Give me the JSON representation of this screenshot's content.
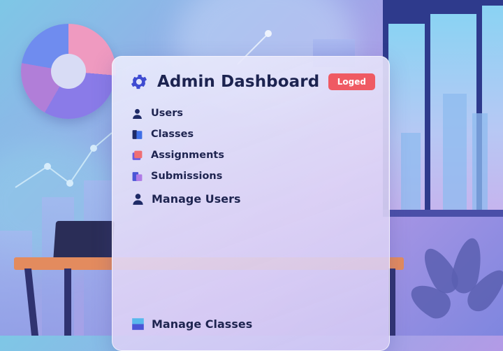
{
  "header": {
    "title": "Admin Dashboard",
    "status_badge": "Loged",
    "icon": "gear-icon"
  },
  "nav": {
    "items": [
      {
        "label": "Users",
        "icon": "user-icon"
      },
      {
        "label": "Classes",
        "icon": "classes-icon"
      },
      {
        "label": "Assignments",
        "icon": "assignments-icon"
      },
      {
        "label": "Submissions",
        "icon": "submissions-icon"
      }
    ]
  },
  "sections": {
    "manage_users": {
      "label": "Manage Users",
      "icon": "user-icon"
    },
    "manage_classes": {
      "label": "Manage Classes",
      "icon": "classes-icon"
    }
  },
  "colors": {
    "accent": "#3f4bd1",
    "badge": "#ef5a63",
    "text": "#1e2450"
  }
}
